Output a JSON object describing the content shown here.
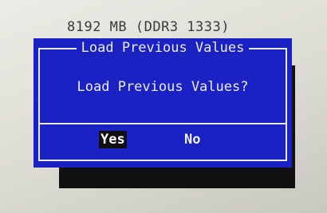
{
  "background": {
    "memory_text": "8192 MB (DDR3 1333)"
  },
  "dialog": {
    "title": "Load Previous Values",
    "question": "Load Previous Values?",
    "buttons": {
      "yes": "Yes",
      "no": "No"
    },
    "selected": "Yes"
  },
  "colors": {
    "dialog_bg": "#1a22c4",
    "text": "#ececf6",
    "shadow": "#111113",
    "selected_bg": "#101014",
    "screen_bg": "#e4e3dc"
  }
}
